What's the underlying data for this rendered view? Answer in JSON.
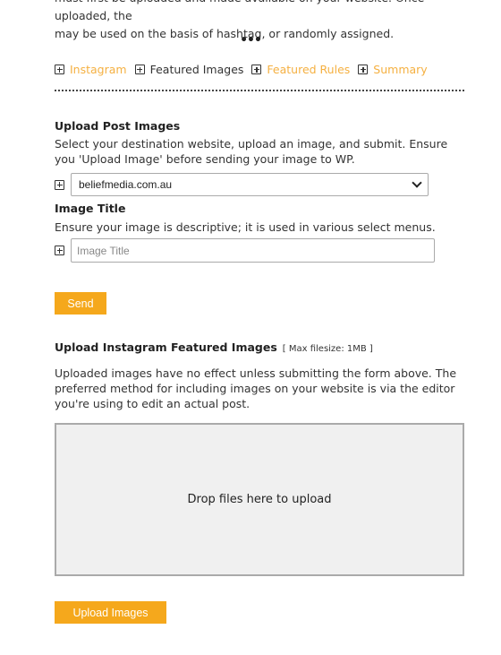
{
  "intro": {
    "line1": "must first be uploaded and made available on your website. Once uploaded, the",
    "line2": "may be used on the basis of hashtag, or randomly assigned."
  },
  "divider_dots": "•••",
  "tabs": [
    {
      "label": "Instagram",
      "style": "link"
    },
    {
      "label": "Featured Images",
      "style": "plain"
    },
    {
      "label": "Featured Rules",
      "style": "link"
    },
    {
      "label": "Summary",
      "style": "link"
    }
  ],
  "upload_post": {
    "heading": "Upload Post Images",
    "description": "Select your destination website, upload an image, and submit. Ensure you 'Upload Image' before sending your image to WP.",
    "website_select": {
      "value": "beliefmedia.com.au"
    }
  },
  "image_title": {
    "heading": "Image Title",
    "description": "Ensure your image is descriptive; it is used in various select menus.",
    "input": {
      "value": "",
      "placeholder": "Image Title"
    }
  },
  "send_button": "Send",
  "instagram_upload": {
    "heading": "Upload Instagram Featured Images",
    "max_filesize": "[ Max filesize: 1MB ]",
    "description": "Uploaded images have no effect unless submitting the form above. The preferred method for including images on your website is via the editor you're using to edit an actual post.",
    "dropzone_text": "Drop files here to upload",
    "upload_button": "Upload Images"
  },
  "colors": {
    "accent": "#f5a81c",
    "link": "#f5b041",
    "dropzone_bg": "#f0f0f0"
  }
}
